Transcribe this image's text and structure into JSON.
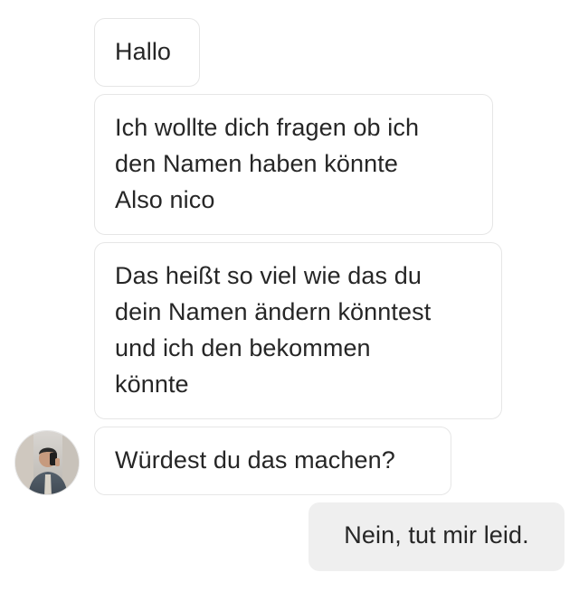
{
  "conversation": {
    "incoming_messages": [
      {
        "text": "Hallo"
      },
      {
        "text": "Ich wollte dich fragen ob ich\nden Namen haben könnte\nAlso nico"
      },
      {
        "text": "Das heißt so viel wie das du\ndein Namen ändern könntest\nund ich den bekommen\nkönnte"
      },
      {
        "text": "Würdest du das machen?"
      }
    ],
    "outgoing_messages": [
      {
        "text": "Nein, tut mir leid."
      }
    ]
  },
  "colors": {
    "incoming_bubble_bg": "#ffffff",
    "incoming_bubble_border": "#e6e6e6",
    "outgoing_bubble_bg": "#efefef",
    "text": "#262626"
  },
  "icons": {
    "avatar": "user-avatar-photo"
  }
}
